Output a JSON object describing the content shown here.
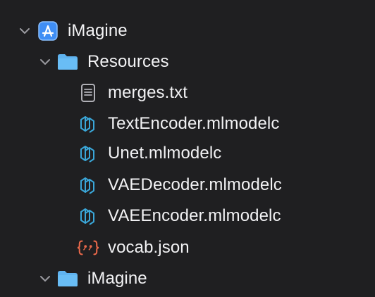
{
  "tree": {
    "project": {
      "label": "iMagine",
      "icon": "xcode-app-icon",
      "expanded": true
    },
    "resources_group": {
      "label": "Resources",
      "icon": "folder-icon",
      "expanded": true
    },
    "files": [
      {
        "label": "merges.txt",
        "icon": "text-file-icon"
      },
      {
        "label": "TextEncoder.mlmodelc",
        "icon": "mlmodel-icon"
      },
      {
        "label": "Unet.mlmodelc",
        "icon": "mlmodel-icon"
      },
      {
        "label": "VAEDecoder.mlmodelc",
        "icon": "mlmodel-icon"
      },
      {
        "label": "VAEEncoder.mlmodelc",
        "icon": "mlmodel-icon"
      },
      {
        "label": "vocab.json",
        "icon": "json-file-icon"
      }
    ],
    "imagine_group": {
      "label": "iMagine",
      "icon": "folder-icon",
      "expanded": true
    }
  },
  "colors": {
    "background": "#1f1f21",
    "text": "#f2f2f4",
    "chevron": "#9a9aa0",
    "folder": "#5fb3f0",
    "app_icon": "#3f8ef5",
    "mlmodel": "#3aa7d9",
    "json": "#e8684a",
    "text_file": "#b0b0b6"
  }
}
